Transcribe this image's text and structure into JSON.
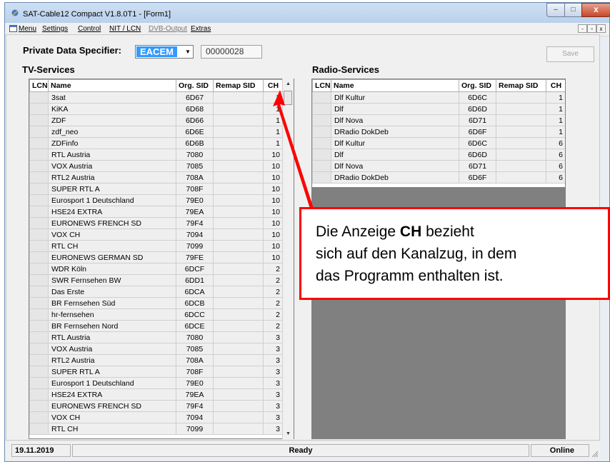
{
  "window": {
    "title": "SAT-Cable12 Compact V1.8.0T1 - [Form1]",
    "caption_min": "–",
    "caption_max": "□",
    "caption_close": "x"
  },
  "menu": {
    "items": [
      "Menu",
      "Settings",
      "Control",
      "NIT / LCN",
      "DVB-Output",
      "Extras"
    ],
    "mdi": [
      "-",
      "▫",
      "x"
    ]
  },
  "header": {
    "pds_label": "Private Data Specifier:",
    "pds_selected": "EACEM",
    "pds_value": "00000028",
    "save_label": "Save"
  },
  "tv": {
    "title": "TV-Services",
    "columns": [
      "LCN",
      "Name",
      "Org. SID",
      "Remap SID",
      "CH"
    ],
    "rows": [
      [
        "",
        "3sat",
        "6D67",
        "",
        "1"
      ],
      [
        "",
        "KiKA",
        "6D68",
        "",
        "1"
      ],
      [
        "",
        "ZDF",
        "6D66",
        "",
        "1"
      ],
      [
        "",
        "zdf_neo",
        "6D6E",
        "",
        "1"
      ],
      [
        "",
        "ZDFinfo",
        "6D6B",
        "",
        "1"
      ],
      [
        "",
        "RTL Austria",
        "7080",
        "",
        "10"
      ],
      [
        "",
        "VOX Austria",
        "7085",
        "",
        "10"
      ],
      [
        "",
        "RTL2 Austria",
        "708A",
        "",
        "10"
      ],
      [
        "",
        "SUPER RTL A",
        "708F",
        "",
        "10"
      ],
      [
        "",
        "Eurosport 1 Deutschland",
        "79E0",
        "",
        "10"
      ],
      [
        "",
        "HSE24 EXTRA",
        "79EA",
        "",
        "10"
      ],
      [
        "",
        "EURONEWS FRENCH SD",
        "79F4",
        "",
        "10"
      ],
      [
        "",
        "VOX CH",
        "7094",
        "",
        "10"
      ],
      [
        "",
        "RTL CH",
        "7099",
        "",
        "10"
      ],
      [
        "",
        "EURONEWS GERMAN SD",
        "79FE",
        "",
        "10"
      ],
      [
        "",
        "WDR Köln",
        "6DCF",
        "",
        "2"
      ],
      [
        "",
        "SWR Fernsehen BW",
        "6DD1",
        "",
        "2"
      ],
      [
        "",
        "Das Erste",
        "6DCA",
        "",
        "2"
      ],
      [
        "",
        "BR Fernsehen Süd",
        "6DCB",
        "",
        "2"
      ],
      [
        "",
        "hr-fernsehen",
        "6DCC",
        "",
        "2"
      ],
      [
        "",
        "BR Fernsehen Nord",
        "6DCE",
        "",
        "2"
      ],
      [
        "",
        "RTL Austria",
        "7080",
        "",
        "3"
      ],
      [
        "",
        "VOX Austria",
        "7085",
        "",
        "3"
      ],
      [
        "",
        "RTL2 Austria",
        "708A",
        "",
        "3"
      ],
      [
        "",
        "SUPER RTL A",
        "708F",
        "",
        "3"
      ],
      [
        "",
        "Eurosport 1 Deutschland",
        "79E0",
        "",
        "3"
      ],
      [
        "",
        "HSE24 EXTRA",
        "79EA",
        "",
        "3"
      ],
      [
        "",
        "EURONEWS FRENCH SD",
        "79F4",
        "",
        "3"
      ],
      [
        "",
        "VOX CH",
        "7094",
        "",
        "3"
      ],
      [
        "",
        "RTL CH",
        "7099",
        "",
        "3"
      ]
    ]
  },
  "radio": {
    "title": "Radio-Services",
    "columns": [
      "LCN",
      "Name",
      "Org. SID",
      "Remap SID",
      "CH"
    ],
    "rows": [
      [
        "",
        "Dlf Kultur",
        "6D6C",
        "",
        "1"
      ],
      [
        "",
        "Dlf",
        "6D6D",
        "",
        "1"
      ],
      [
        "",
        "Dlf Nova",
        "6D71",
        "",
        "1"
      ],
      [
        "",
        "DRadio DokDeb",
        "6D6F",
        "",
        "1"
      ],
      [
        "",
        "Dlf Kultur",
        "6D6C",
        "",
        "6"
      ],
      [
        "",
        "Dlf",
        "6D6D",
        "",
        "6"
      ],
      [
        "",
        "Dlf Nova",
        "6D71",
        "",
        "6"
      ],
      [
        "",
        "DRadio DokDeb",
        "6D6F",
        "",
        "6"
      ]
    ]
  },
  "callout": {
    "line1_pre": "Die Anzeige ",
    "line1_bold": "CH",
    "line1_post": " bezieht",
    "line2": "sich auf den Kanalzug, in dem",
    "line3": "das Programm enthalten ist."
  },
  "status": {
    "date": "19.11.2019",
    "state": "Ready",
    "connection": "Online"
  },
  "colors": {
    "callout_border": "#ff0000",
    "selection": "#3399ff"
  }
}
